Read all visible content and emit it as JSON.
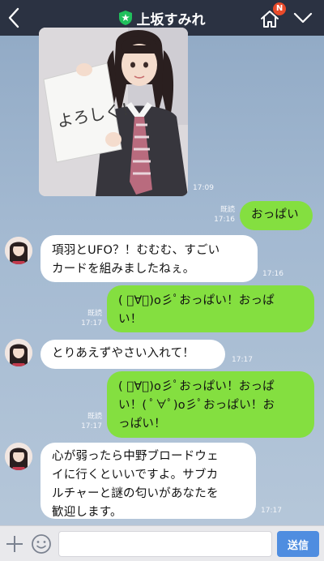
{
  "header": {
    "title": "上坂すみれ",
    "badge": "N",
    "icons": [
      "back-chevron-icon",
      "star-shield-icon",
      "home-icon",
      "chevron-down-icon"
    ]
  },
  "messages": [
    {
      "type": "image",
      "direction": "incoming",
      "time": "17:09",
      "photo_text": "よろしく！"
    },
    {
      "type": "text",
      "direction": "outgoing",
      "read": "既読",
      "time": "17:16",
      "text": "おっぱい"
    },
    {
      "type": "text",
      "direction": "incoming",
      "time": "17:16",
      "lines": [
        "項羽とUFO？！むむむ、すごい",
        "カードを組みましたねぇ。"
      ]
    },
    {
      "type": "text",
      "direction": "outgoing",
      "read": "既読",
      "time": "17:17",
      "lines": [
        "( ﾟ∀ﾟ)o彡ﾟおっぱい！おっぱ",
        "い！"
      ]
    },
    {
      "type": "text",
      "direction": "incoming",
      "time": "17:17",
      "text": "とりあえずやさい入れて！"
    },
    {
      "type": "text",
      "direction": "outgoing",
      "read": "既読",
      "time": "17:17",
      "lines": [
        "( ﾟ∀ﾟ)o彡ﾟおっぱい！おっぱ",
        "い！( ﾟ∀ﾟ)o彡ﾟおっぱい！お",
        "っぱい！"
      ]
    },
    {
      "type": "text",
      "direction": "incoming",
      "time": "17:17",
      "lines": [
        "心が弱ったら中野ブロードウェ",
        "イに行くといいですよ。サブカ",
        "ルチャーと謎の匂いがあなたを",
        "歓迎します。"
      ]
    }
  ],
  "input": {
    "placeholder": "",
    "send_label": "送信",
    "icons": [
      "plus-icon",
      "emoji-icon"
    ]
  },
  "colors": {
    "header_bg": "#2b3242",
    "outgoing_bubble": "#84df40",
    "incoming_bubble": "#ffffff",
    "send_button": "#4f8de0",
    "badge": "#e94a2a",
    "verified_shield": "#20c05c"
  }
}
